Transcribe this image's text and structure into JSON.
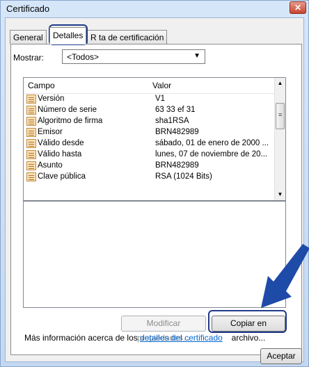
{
  "window": {
    "title": "Certificado",
    "close_symbol": "✕"
  },
  "tabs": [
    {
      "label": "General"
    },
    {
      "label": "Detalles"
    },
    {
      "label": "Ruta de certificación",
      "visible_text": "R  ta de certificación"
    }
  ],
  "show": {
    "label": "Mostrar:",
    "selected": "<Todos>"
  },
  "list": {
    "headers": {
      "field": "Campo",
      "value": "Valor"
    },
    "rows": [
      {
        "field": "Versión",
        "value": "V1"
      },
      {
        "field": "Número de serie",
        "value": "63 33 ef 31"
      },
      {
        "field": "Algoritmo de firma",
        "value": "sha1RSA"
      },
      {
        "field": "Emisor",
        "value": "BRN482989"
      },
      {
        "field": "Válido desde",
        "value": "sábado, 01 de enero de 2000 ..."
      },
      {
        "field": "Válido hasta",
        "value": "lunes, 07 de noviembre de 20..."
      },
      {
        "field": "Asunto",
        "value": "BRN482989"
      },
      {
        "field": "Clave pública",
        "value": "RSA (1024 Bits)"
      }
    ]
  },
  "buttons": {
    "edit_properties": "Modificar propiedades...",
    "copy_to_file": "Copiar en archivo...",
    "accept": "Aceptar"
  },
  "info": {
    "prefix": "Más información acerca de los ",
    "link": "detalles del certificado"
  },
  "colors": {
    "highlight": "#1f3a8a",
    "arrow": "#1e4aa8",
    "link": "#0066cc"
  }
}
